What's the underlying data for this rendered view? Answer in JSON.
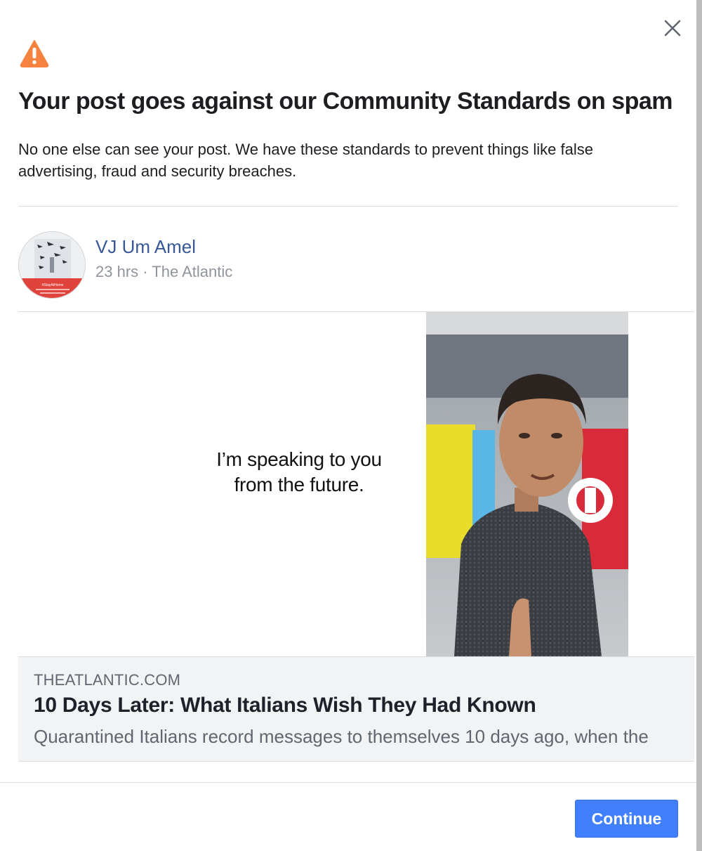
{
  "dialog": {
    "title": "Your post goes against our Community Standards on spam",
    "description": "No one else can see your post. We have these standards to prevent things like false advertising, fraud and security breaches.",
    "warning_icon": "warning-triangle-icon",
    "close_icon": "close-icon",
    "continue_label": "Continue"
  },
  "post": {
    "author": "VJ Um Amel",
    "meta": "23 hrs · The Atlantic",
    "avatar_badge": "#StayAtHome",
    "media_quote_line1": "I’m speaking to you",
    "media_quote_line2": "from the future.",
    "link": {
      "domain": "THEATLANTIC.COM",
      "headline": "10 Days Later: What Italians Wish They Had Known",
      "snippet": "Quarantined Italians record messages to themselves 10 days ago, when the"
    }
  },
  "colors": {
    "accent": "#4080ff",
    "author_link": "#385898",
    "warning": "#f5833f"
  }
}
